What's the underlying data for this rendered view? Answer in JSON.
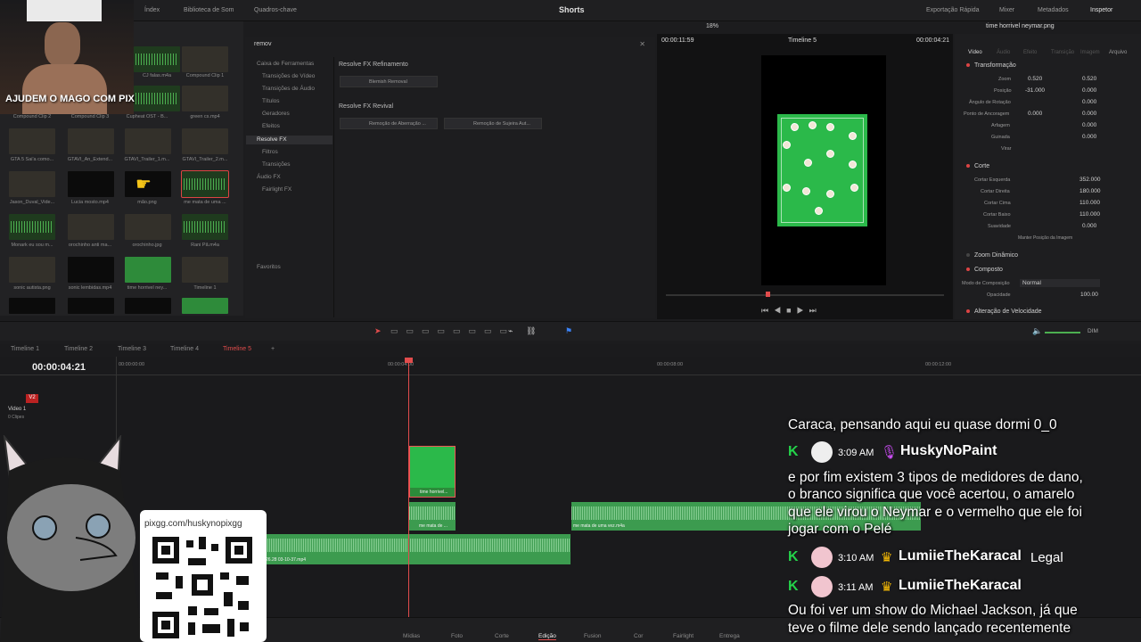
{
  "topbar": {
    "left_items": [
      "Índex",
      "Biblioteca de Som",
      "Quadros-chave"
    ],
    "title": "Shorts",
    "right_items": [
      "Exportação Rápida",
      "Mixer",
      "Metadados",
      "Inspetor"
    ]
  },
  "media_pool": {
    "items": [
      {
        "label": "CJ falas.m4a"
      },
      {
        "label": "Compound Clip 1"
      },
      {
        "label": "Compound Clip 2"
      },
      {
        "label": "Compound Clip 3"
      },
      {
        "label": "Cupheat OST - B..."
      },
      {
        "label": "green cs.mp4"
      },
      {
        "label": "GTA 5 Sai'a como..."
      },
      {
        "label": "GTAVI_An_Extend..."
      },
      {
        "label": "GTAVI_Trailer_1.m..."
      },
      {
        "label": "GTAVI_Trailer_2.m..."
      },
      {
        "label": "Jason_Duval_Vide..."
      },
      {
        "label": "Lucia mosto.mp4"
      },
      {
        "label": "mão.png"
      },
      {
        "label": "me mata de uma ..."
      },
      {
        "label": "Monark eu sou m..."
      },
      {
        "label": "orochinho anti ma..."
      },
      {
        "label": "orochinho.jpg"
      },
      {
        "label": "Rani Pã.m4a"
      },
      {
        "label": "sonic autista.png"
      },
      {
        "label": "sonic lembidas.mp4"
      },
      {
        "label": "time horrivel ney..."
      },
      {
        "label": "Timeline 1"
      }
    ]
  },
  "effects": {
    "search_value": "remov",
    "tree": [
      "Caixa de Ferramentas",
      "Transições de Vídeo",
      "Transições de Áudio",
      "Títulos",
      "Geradores",
      "Efeitos",
      "Resolve FX",
      "Filtros",
      "Transições",
      "Áudio FX",
      "Fairlight FX"
    ],
    "favorites": "Favoritos",
    "section_refinement": "Resolve FX Refinamento",
    "refinement_items": [
      "Blemish Removal"
    ],
    "section_revival": "Resolve FX Revival",
    "revival_items": [
      "Remoção de Aberração ...",
      "Remoção de Sujeira Aut..."
    ]
  },
  "viewer": {
    "zoom": "18%",
    "timecode_left": "00:00:11:59",
    "timeline_name": "Timeline 5",
    "timecode_right": "00:00:04:21"
  },
  "inspector": {
    "clip_name": "time horrivel neymar.png",
    "tabs": [
      "Vídeo",
      "Áudio",
      "Efeito",
      "Transição",
      "Imagem",
      "Arquivo"
    ],
    "transform_title": "Transformação",
    "zoom_label": "Zoom",
    "zoom_x": "0.520",
    "zoom_y": "0.520",
    "position_label": "Posição",
    "position_x": "-31.000",
    "position_y": "0.000",
    "rotation_label": "Ângulo de Rotação",
    "rotation_value": "0.000",
    "anchor_label": "Ponto de Ancoragem",
    "anchor_x": "0.000",
    "anchor_y": "0.000",
    "pitch_label": "Arfagem",
    "pitch_value": "0.000",
    "yaw_label": "Guinada",
    "yaw_value": "0.000",
    "flip_label": "Virar",
    "crop_title": "Corte",
    "crop_left_label": "Cortar Esquerda",
    "crop_left": "352.000",
    "crop_right_label": "Cortar Direita",
    "crop_right": "180.000",
    "crop_top_label": "Cortar Cima",
    "crop_top": "110.000",
    "crop_bottom_label": "Cortar Baixo",
    "crop_bottom": "110.000",
    "softness_label": "Suavidade",
    "softness": "0.000",
    "retain_label": "Manter Posição da Imagem",
    "dynamic_zoom": "Zoom Dinâmico",
    "composite_title": "Composto",
    "composite_mode_label": "Modo de Composição",
    "composite_mode": "Normal",
    "opacity_label": "Opacidade",
    "opacity": "100.00",
    "speed_title": "Alteração de Velocidade"
  },
  "timeline": {
    "tabs": [
      "Timeline 1",
      "Timeline 2",
      "Timeline 3",
      "Timeline 4",
      "Timeline 5"
    ],
    "active_tab": "Timeline 5",
    "timecode": "00:00:04:21",
    "ruler": [
      "00:00:00:00",
      "00:00:04:00",
      "00:00:08:00",
      "00:00:12:00"
    ],
    "video_track_label": "Video 1",
    "video_track_sub": "0 Clipes",
    "track_v2": "V2",
    "clips": {
      "video": "time horrivel...",
      "audio1": "me mata de ...",
      "audio2": "me mata de uma vez.m4a",
      "audio3": "26.28 03-10-37.mp4"
    },
    "audio_level_label": "DIM"
  },
  "pages": [
    "Mídias",
    "Foto",
    "Corte",
    "Edição",
    "Fusion",
    "Cor",
    "Fairlight",
    "Entrega"
  ],
  "active_page": "Edição",
  "overlay": {
    "wizard_caption": "AJUDEM O MAGO COM PIX",
    "qr_url": "pixgg.com/huskynopixgg"
  },
  "chat": {
    "line1": "Caraca, pensando aqui eu quase dormi 0_0",
    "msg1_time": "3:09 AM",
    "msg1_user": "HuskyNoPaint",
    "msg1_lines": [
      "e por fim existem 3 tipos de medidores de dano,",
      "o branco significa que você acertou, o amarelo",
      "que ele virou o Neymar e o vermelho que ele foi",
      "jogar com o Pelé"
    ],
    "msg2_time": "3:10 AM",
    "msg2_user": "LumiieTheKaracal",
    "msg2_text": "Legal",
    "msg3_time": "3:11 AM",
    "msg3_user": "LumiieTheKaracal",
    "msg3_lines": [
      "Ou foi ver um show do Michael Jackson, já que",
      "teve o filme dele sendo lançado recentemente"
    ],
    "accent_green": "#24d34a",
    "crown_color": "#f2b705"
  }
}
